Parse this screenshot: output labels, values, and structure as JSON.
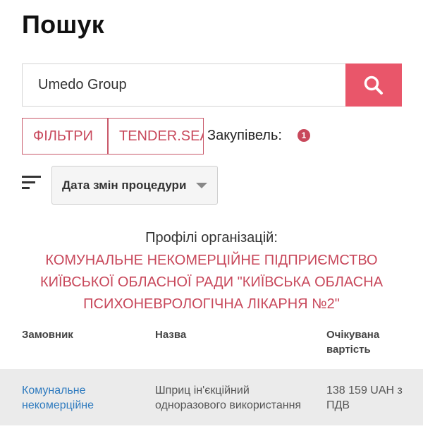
{
  "page": {
    "title": "Пошук"
  },
  "search": {
    "value": "Umedo Group"
  },
  "tabs": {
    "filters": "ФІЛЬТРИ",
    "tender_search": "TENDER.SEA"
  },
  "buyer": {
    "label": "Закупівель:",
    "count": "1"
  },
  "sort": {
    "label": "Дата змін процедури"
  },
  "org_profiles": {
    "heading": "Профілі організацій:",
    "name": "КОМУНАЛЬНЕ НЕКОМЕРЦІЙНЕ ПІДПРИЄМСТВО КИЇВСЬКОЇ ОБЛАСНОЇ РАДИ \"КИЇВСЬКА ОБЛАСНА ПСИХОНЕВРОЛОГІЧНА ЛІКАРНЯ №2\""
  },
  "table": {
    "headers": {
      "customer": "Замовник",
      "name": "Назва",
      "value": "Очікувана вартість"
    },
    "rows": [
      {
        "customer": "Комунальне некомерційне",
        "name": "Шприц ін'єкційний одноразового використання",
        "value": "138 159 UAH з ПДВ"
      }
    ]
  },
  "colors": {
    "accent": "#e9566a",
    "link": "#2f7bbf",
    "brand_text": "#c8485b"
  },
  "icons": {
    "search": "magnifier-icon",
    "sort": "sort-lines-icon"
  }
}
